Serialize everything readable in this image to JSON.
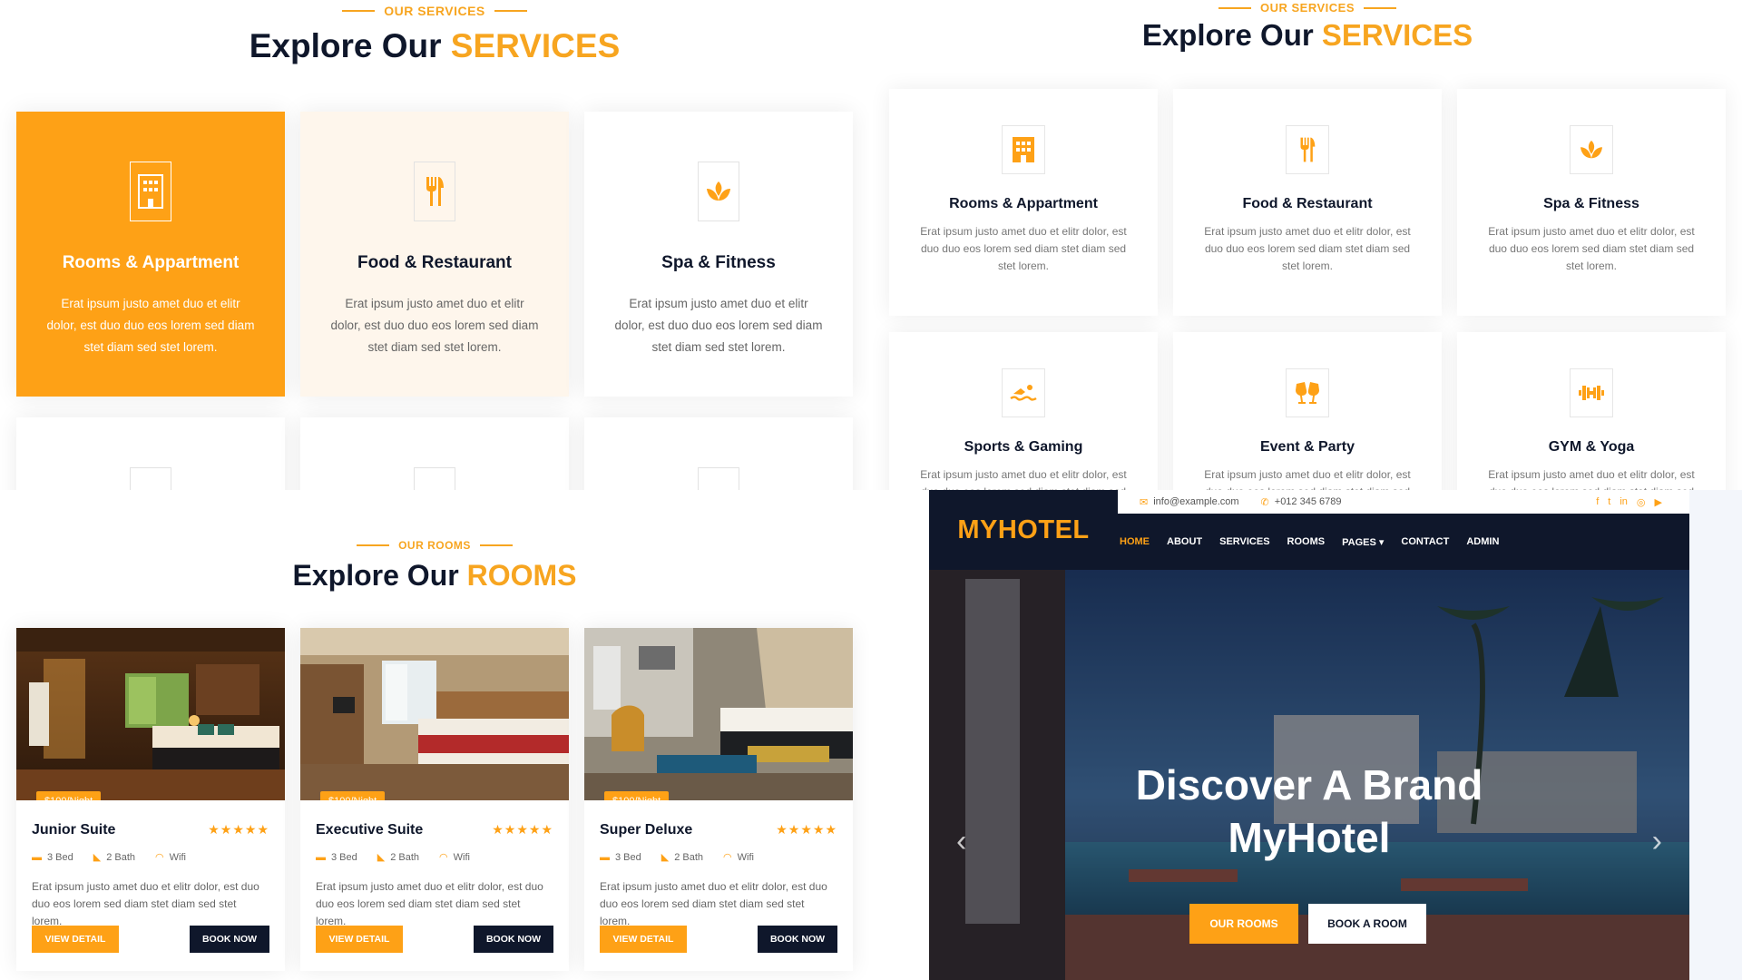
{
  "colors": {
    "accent": "#fea116",
    "dark": "#0f172b",
    "soft": "#fef6ec"
  },
  "services_a": {
    "subtitle": "OUR SERVICES",
    "title_main": "Explore Our",
    "title_accent": "SERVICES",
    "cards": [
      {
        "title": "Rooms & Appartment",
        "text": "Erat ipsum justo amet duo et elitr dolor, est duo duo eos lorem sed diam stet diam sed stet lorem.",
        "icon": "hotel-icon"
      },
      {
        "title": "Food & Restaurant",
        "text": "Erat ipsum justo amet duo et elitr dolor, est duo duo eos lorem sed diam stet diam sed stet lorem.",
        "icon": "utensils-icon"
      },
      {
        "title": "Spa & Fitness",
        "text": "Erat ipsum justo amet duo et elitr dolor, est duo duo eos lorem sed diam stet diam sed stet lorem.",
        "icon": "spa-icon"
      }
    ]
  },
  "services_b": {
    "subtitle": "OUR SERVICES",
    "title_main": "Explore Our",
    "title_accent": "SERVICES",
    "cards": [
      {
        "title": "Rooms & Appartment",
        "text": "Erat ipsum justo amet duo et elitr dolor, est duo duo eos lorem sed diam stet diam sed stet lorem.",
        "icon": "hotel-icon"
      },
      {
        "title": "Food & Restaurant",
        "text": "Erat ipsum justo amet duo et elitr dolor, est duo duo eos lorem sed diam stet diam sed stet lorem.",
        "icon": "utensils-icon"
      },
      {
        "title": "Spa & Fitness",
        "text": "Erat ipsum justo amet duo et elitr dolor, est duo duo eos lorem sed diam stet diam sed stet lorem.",
        "icon": "spa-icon"
      },
      {
        "title": "Sports & Gaming",
        "text": "Erat ipsum justo amet duo et elitr dolor, est duo duo eos lorem sed diam stet diam sed stet lorem.",
        "icon": "swimmer-icon"
      },
      {
        "title": "Event & Party",
        "text": "Erat ipsum justo amet duo et elitr dolor, est duo duo eos lorem sed diam stet diam sed stet lorem.",
        "icon": "glass-cheers-icon"
      },
      {
        "title": "GYM & Yoga",
        "text": "Erat ipsum justo amet duo et elitr dolor, est duo duo eos lorem sed diam stet diam sed stet lorem.",
        "icon": "dumbbell-icon"
      }
    ]
  },
  "rooms": {
    "subtitle": "OUR ROOMS",
    "title_main": "Explore Our",
    "title_accent": "ROOMS",
    "items": [
      {
        "price": "$100/Night",
        "title": "Junior Suite",
        "stars": "★★★★★",
        "bed": "3 Bed",
        "bath": "2 Bath",
        "wifi": "Wifi",
        "text": "Erat ipsum justo amet duo et elitr dolor, est duo duo eos lorem sed diam stet diam sed stet lorem.",
        "view": "VIEW DETAIL",
        "book": "BOOK NOW"
      },
      {
        "price": "$100/Night",
        "title": "Executive Suite",
        "stars": "★★★★★",
        "bed": "3 Bed",
        "bath": "2 Bath",
        "wifi": "Wifi",
        "text": "Erat ipsum justo amet duo et elitr dolor, est duo duo eos lorem sed diam stet diam sed stet lorem.",
        "view": "VIEW DETAIL",
        "book": "BOOK NOW"
      },
      {
        "price": "$100/Night",
        "title": "Super Deluxe",
        "stars": "★★★★★",
        "bed": "3 Bed",
        "bath": "2 Bath",
        "wifi": "Wifi",
        "text": "Erat ipsum justo amet duo et elitr dolor, est duo duo eos lorem sed diam stet diam sed stet lorem.",
        "view": "VIEW DETAIL",
        "book": "BOOK NOW"
      }
    ]
  },
  "hotel": {
    "brand": "MYHOTEL",
    "email": "info@example.com",
    "phone": "+012 345 6789",
    "nav": [
      "HOME",
      "ABOUT",
      "SERVICES",
      "ROOMS",
      "PAGES ▾",
      "CONTACT",
      "ADMIN"
    ],
    "social": [
      "f",
      "t",
      "in",
      "◎",
      "▶"
    ],
    "hero_line1": "Discover A Brand",
    "hero_line2": "MyHotel",
    "btn_rooms": "OUR ROOMS",
    "btn_book": "BOOK A ROOM",
    "prev": "‹",
    "next": "›"
  }
}
